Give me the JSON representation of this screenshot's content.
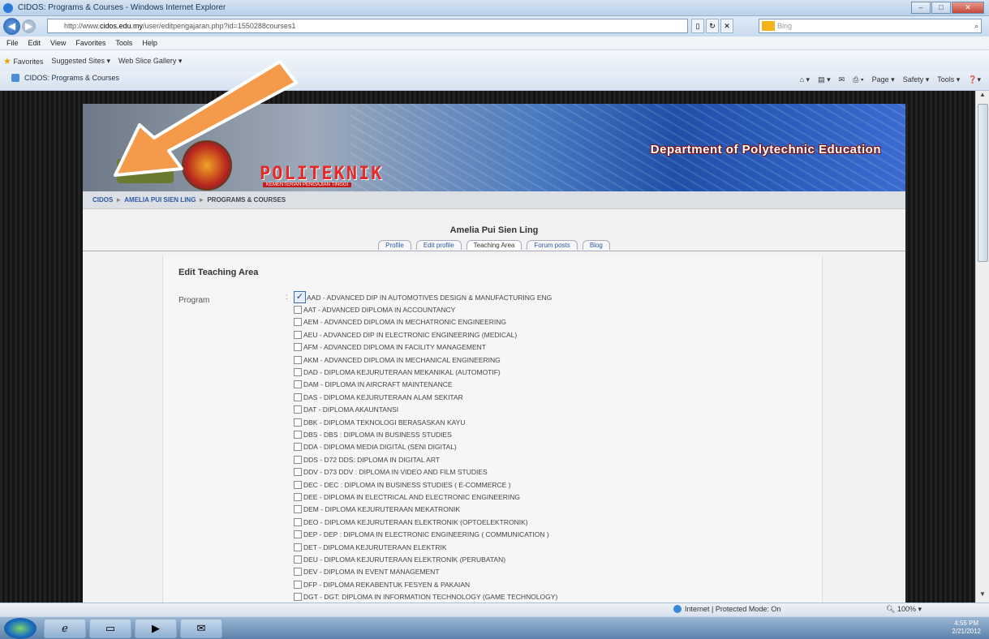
{
  "window": {
    "title": "CIDOS: Programs & Courses - Windows Internet Explorer",
    "buttons": [
      "–",
      "□",
      "✕"
    ]
  },
  "address": {
    "url_prefix": "http://www.",
    "url_domain": "cidos.edu.my",
    "url_path": "/user/editpengajaran.php?id=1550288courses1",
    "search_placeholder": "Bing"
  },
  "menu": [
    "File",
    "Edit",
    "View",
    "Favorites",
    "Tools",
    "Help"
  ],
  "favorites": {
    "label": "Favorites",
    "items": [
      "Suggested Sites ▾",
      "Web Slice Gallery ▾"
    ]
  },
  "tab": {
    "label": "CIDOS: Programs & Courses"
  },
  "commandbar": [
    "Page ▾",
    "Safety ▾",
    "Tools ▾"
  ],
  "banner": {
    "politeknik": "POLITEKNIK",
    "politeknik_sub": "KEMENTERIAN PENGAJIAN TINGGI",
    "department": "Department of Polytechnic Education"
  },
  "breadcrumb": [
    "CIDOS",
    "AMELIA PUI SIEN LING",
    "PROGRAMS & COURSES"
  ],
  "user_name": "Amelia Pui Sien Ling",
  "profile_tabs": [
    "Profile",
    "Edit profile",
    "Teaching Area",
    "Forum posts",
    "Blog"
  ],
  "form": {
    "section_title": "Edit Teaching Area",
    "program_label": "Program",
    "programs": [
      {
        "label": "AAD - ADVANCED DIP IN AUTOMOTIVES DESIGN & MANUFACTURING ENG",
        "checked": true
      },
      {
        "label": "AAT - ADVANCED DIPLOMA IN ACCOUNTANCY",
        "checked": false
      },
      {
        "label": "AEM - ADVANCED DIPLOMA IN MECHATRONIC ENGINEERING",
        "checked": false
      },
      {
        "label": "AEU - ADVANCED DIP IN ELECTRONIC ENGINEERING (MEDICAL)",
        "checked": false
      },
      {
        "label": "AFM - ADVANCED DIPLOMA IN FACILITY MANAGEMENT",
        "checked": false
      },
      {
        "label": "AKM - ADVANCED DIPLOMA IN MECHANICAL ENGINEERING",
        "checked": false
      },
      {
        "label": "DAD - DIPLOMA KEJURUTERAAN MEKANIKAL (AUTOMOTIF)",
        "checked": false
      },
      {
        "label": "DAM - DIPLOMA IN AIRCRAFT MAINTENANCE",
        "checked": false
      },
      {
        "label": "DAS - DIPLOMA KEJURUTERAAN ALAM SEKITAR",
        "checked": false
      },
      {
        "label": "DAT - DIPLOMA AKAUNTANSI",
        "checked": false
      },
      {
        "label": "DBK - DIPLOMA TEKNOLOGI BERASASKAN KAYU",
        "checked": false
      },
      {
        "label": "DBS - DBS : DIPLOMA IN BUSINESS STUDIES",
        "checked": false
      },
      {
        "label": "DDA - DIPLOMA MEDIA DIGITAL (SENI DIGITAL)",
        "checked": false
      },
      {
        "label": "DDS - D72 DDS: DIPLOMA IN DIGITAL ART",
        "checked": false
      },
      {
        "label": "DDV - D73 DDV : DIPLOMA IN VIDEO AND FILM STUDIES",
        "checked": false
      },
      {
        "label": "DEC - DEC : DIPLOMA IN BUSINESS STUDIES ( E-COMMERCE )",
        "checked": false
      },
      {
        "label": "DEE - DIPLOMA IN ELECTRICAL AND ELECTRONIC ENGINEERING",
        "checked": false
      },
      {
        "label": "DEM - DIPLOMA KEJURUTERAAN MEKATRONIK",
        "checked": false
      },
      {
        "label": "DEO - DIPLOMA KEJURUTERAAN ELEKTRONIK (OPTOELEKTRONIK)",
        "checked": false
      },
      {
        "label": "DEP - DEP : DIPLOMA IN ELECTRONIC ENGINEERING ( COMMUNICATION )",
        "checked": false
      },
      {
        "label": "DET - DIPLOMA KEJURUTERAAN ELEKTRIK",
        "checked": false
      },
      {
        "label": "DEU - DIPLOMA KEJURUTERAAN ELEKTRONIK (PERUBATAN)",
        "checked": false
      },
      {
        "label": "DEV - DIPLOMA IN EVENT MANAGEMENT",
        "checked": false
      },
      {
        "label": "DFP - DIPLOMA REKABENTUK FESYEN & PAKAIAN",
        "checked": false
      },
      {
        "label": "DGT - DGT: DIPLOMA IN INFORMATION TECHNOLOGY (GAME TECHNOLOGY)",
        "checked": false
      }
    ]
  },
  "status": {
    "zone": "Internet | Protected Mode: On",
    "zoom": "100%"
  },
  "clock": {
    "time": "4:55 PM",
    "date": "2/21/2012"
  }
}
